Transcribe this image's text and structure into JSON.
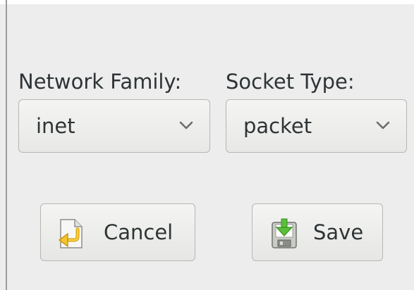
{
  "form": {
    "network_family_label": "Network Family:",
    "socket_type_label": "Socket Type:",
    "network_family_value": "inet",
    "socket_type_value": "packet"
  },
  "actions": {
    "cancel_label": "Cancel",
    "save_label": "Save"
  },
  "icons": {
    "cancel": "undo-arrow-document-icon",
    "save": "save-floppy-download-icon",
    "dropdown": "chevron-down-icon"
  }
}
